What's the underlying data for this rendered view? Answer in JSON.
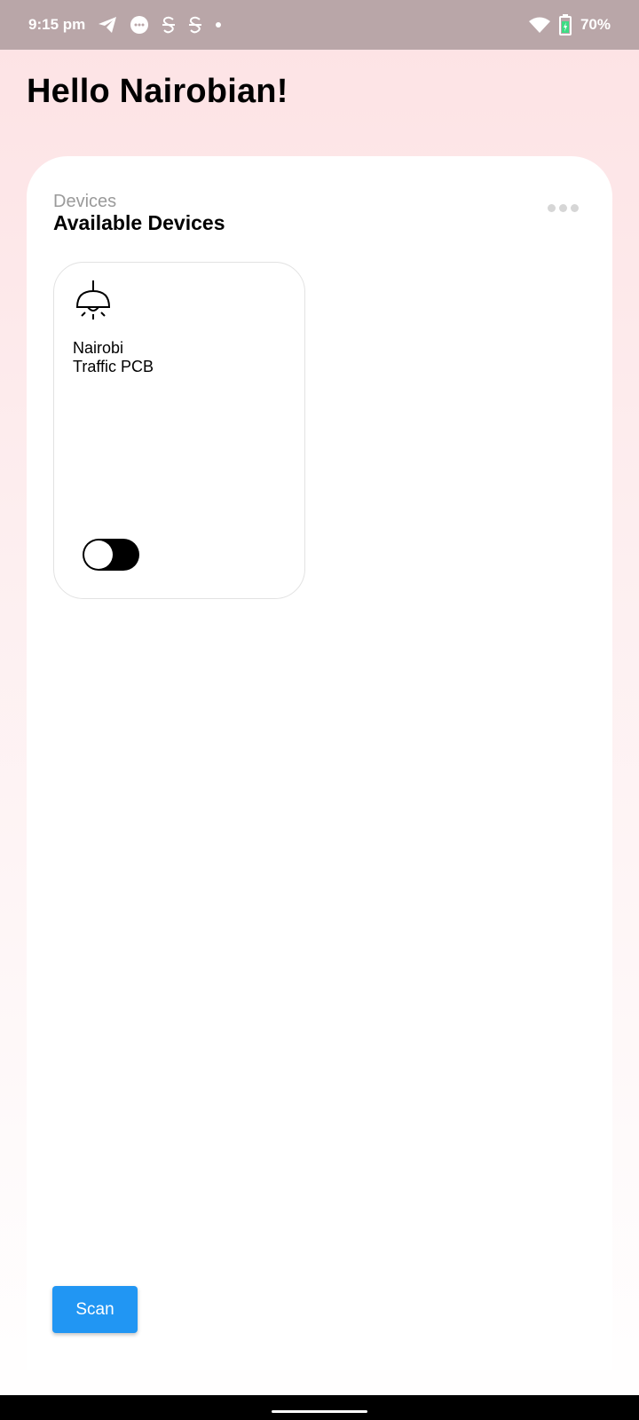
{
  "status_bar": {
    "time": "9:15 pm",
    "battery": "70%",
    "icons": [
      "telegram-icon",
      "messages-icon",
      "s-app-icon",
      "s-app-icon",
      "dot-icon",
      "wifi-icon",
      "battery-charging-icon"
    ]
  },
  "greeting": "Hello Nairobian!",
  "devices": {
    "label": "Devices",
    "title": "Available Devices",
    "items": [
      {
        "name": "Nairobi\nTraffic PCB",
        "icon": "ceiling-lamp-icon",
        "switch_on": false
      }
    ]
  },
  "scan_label": "Scan",
  "colors": {
    "accent": "#2196f3",
    "status_bar": "#b9a6a8",
    "background_top": "#fde2e4"
  }
}
